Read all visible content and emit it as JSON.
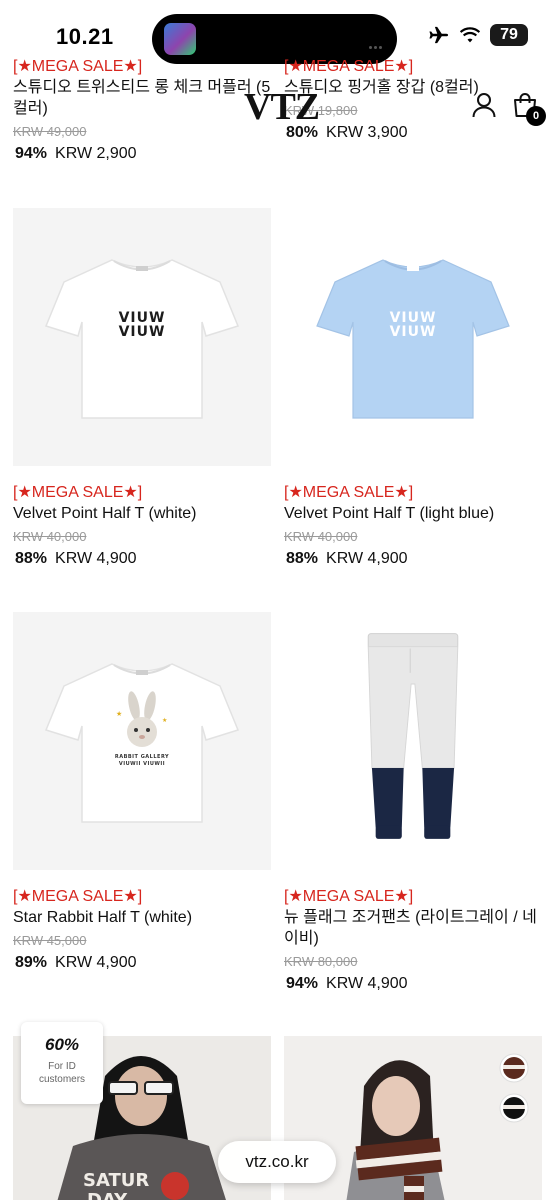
{
  "status_bar": {
    "time": "10.21",
    "battery": "79"
  },
  "header": {
    "logo": "VTZ",
    "cart_count": "0"
  },
  "products": [
    {
      "sale_tag": "[★MEGA SALE★]",
      "name": "스튜디오 트위스티드 롱 체크 머플러 (5컬러)",
      "original_price": "KRW 49,000",
      "discount": "94%",
      "price": "KRW 2,900"
    },
    {
      "sale_tag": "[★MEGA SALE★]",
      "name": "스튜디오 핑거홀 장갑 (8컬러)",
      "original_price": "KRW 19,800",
      "discount": "80%",
      "price": "KRW 3,900"
    },
    {
      "sale_tag": "[★MEGA SALE★]",
      "name": "Velvet Point Half T (white)",
      "original_price": "KRW 40,000",
      "discount": "88%",
      "price": "KRW 4,900",
      "print": [
        "VIUW",
        "VIUW"
      ]
    },
    {
      "sale_tag": "[★MEGA SALE★]",
      "name": "Velvet Point Half T (light blue)",
      "original_price": "KRW 40,000",
      "discount": "88%",
      "price": "KRW 4,900",
      "print": [
        "VIUW",
        "VIUW"
      ]
    },
    {
      "sale_tag": "[★MEGA SALE★]",
      "name": "Star Rabbit Half T (white)",
      "original_price": "KRW 45,000",
      "discount": "89%",
      "price": "KRW 4,900",
      "print": [
        "RABBIT GALLERY",
        "VIUWII VIUWII"
      ]
    },
    {
      "sale_tag": "[★MEGA SALE★]",
      "name": "뉴 플래그 조거팬츠 (라이트그레이 / 네이비)",
      "original_price": "KRW 80,000",
      "discount": "94%",
      "price": "KRW 4,900"
    }
  ],
  "promo": {
    "percent": "60%",
    "line1": "For ID",
    "line2": "customers"
  },
  "banner_shirt_text": [
    "SATUR",
    "DAY"
  ],
  "url_bar": {
    "text": "vtz.co.kr"
  }
}
